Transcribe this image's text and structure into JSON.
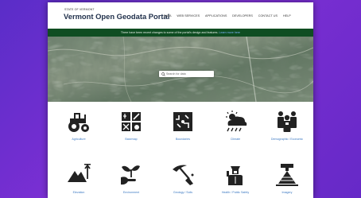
{
  "header": {
    "state_label": "STATE OF VERMONT",
    "title": "Vermont Open Geodata Portal",
    "nav": [
      "DATA",
      "WEB SERVICES",
      "APPLICATIONS",
      "DEVELOPERS",
      "CONTACT US",
      "HELP"
    ]
  },
  "banner": {
    "text": "There have been recent changes to some of the portal's design and features.",
    "link": "Learn more here"
  },
  "search": {
    "placeholder": "Search for data"
  },
  "categories": [
    {
      "label": "Agriculture",
      "icon": "tractor-icon"
    },
    {
      "label": "Basemap",
      "icon": "basemap-icon"
    },
    {
      "label": "Boundaries",
      "icon": "boundaries-icon"
    },
    {
      "label": "Climate",
      "icon": "cloud-rain-icon"
    },
    {
      "label": "Demographic / Economic",
      "icon": "people-icon"
    },
    {
      "label": "Elevation",
      "icon": "mountain-icon"
    },
    {
      "label": "Environment",
      "icon": "plant-hands-icon"
    },
    {
      "label": "Geology / Soils",
      "icon": "pickaxe-icon"
    },
    {
      "label": "Health / Public Safety",
      "icon": "officer-icon"
    },
    {
      "label": "Imagery",
      "icon": "satellite-icon"
    }
  ],
  "colors": {
    "background": "#6a2fd0",
    "banner": "#0f4d22",
    "title": "#1f2f4a",
    "link": "#3a78c2",
    "icon": "#222222"
  }
}
